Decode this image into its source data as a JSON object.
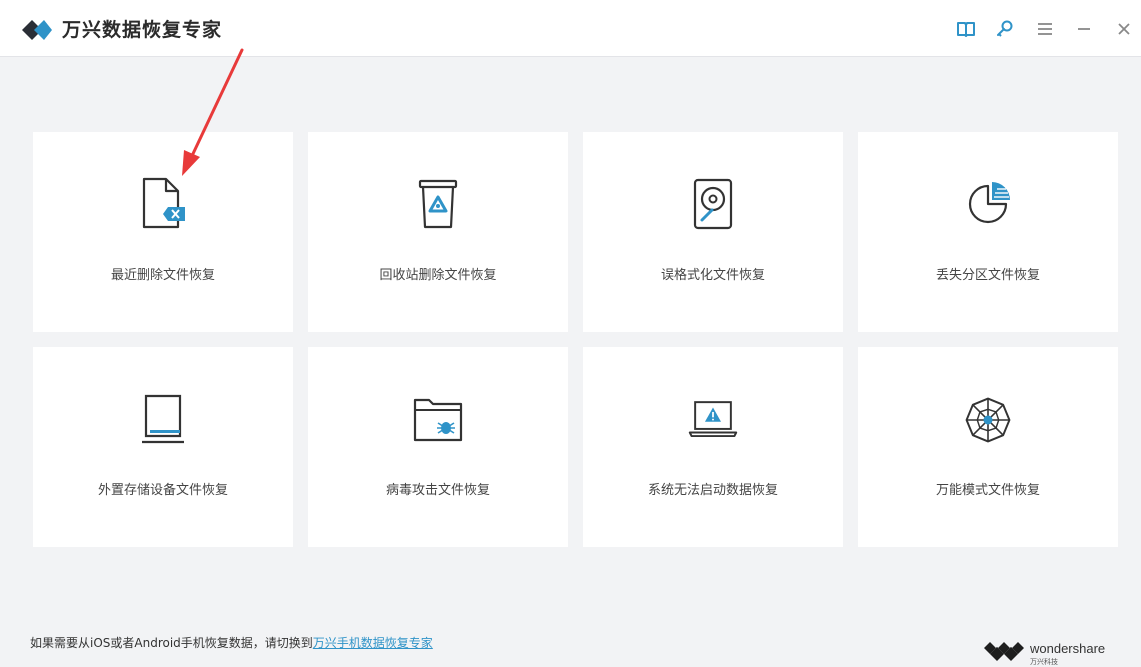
{
  "app": {
    "title": "万兴数据恢复专家"
  },
  "toolbar": {
    "icons": [
      "book-icon",
      "key-icon",
      "menu-icon",
      "minimize-icon",
      "close-icon"
    ]
  },
  "cards": [
    {
      "label": "最近删除文件恢复",
      "icon": "deleted-file-icon"
    },
    {
      "label": "回收站删除文件恢复",
      "icon": "recycle-bin-icon"
    },
    {
      "label": "误格式化文件恢复",
      "icon": "hard-drive-icon"
    },
    {
      "label": "丢失分区文件恢复",
      "icon": "partition-icon"
    },
    {
      "label": "外置存储设备文件恢复",
      "icon": "external-storage-icon"
    },
    {
      "label": "病毒攻击文件恢复",
      "icon": "virus-folder-icon"
    },
    {
      "label": "系统无法启动数据恢复",
      "icon": "laptop-warning-icon"
    },
    {
      "label": "万能模式文件恢复",
      "icon": "web-mode-icon"
    }
  ],
  "footer": {
    "note": "如果需要从iOS或者Android手机恢复数据，请切换到",
    "link": "万兴手机数据恢复专家"
  },
  "brand": {
    "name": "wondershare",
    "sub": "万兴科技"
  },
  "colors": {
    "accent": "#2f93c8",
    "annotation": "#e83a3a",
    "background": "#f2f3f5"
  }
}
